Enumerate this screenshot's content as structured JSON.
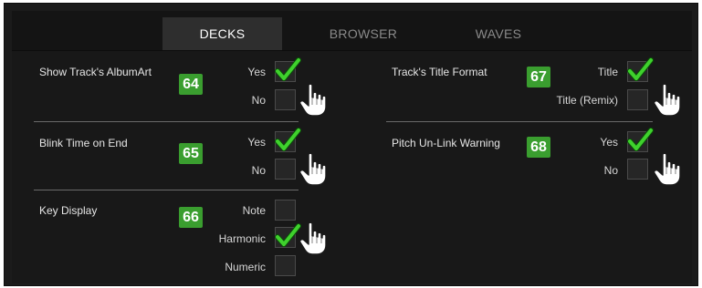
{
  "tabs": [
    {
      "label": "DECKS",
      "active": true
    },
    {
      "label": "BROWSER",
      "active": false
    },
    {
      "label": "WAVES",
      "active": false
    }
  ],
  "settings": [
    {
      "label": "Show Track's AlbumArt",
      "badge": "64",
      "options": [
        {
          "label": "Yes",
          "checked": true
        },
        {
          "label": "No",
          "checked": false
        }
      ]
    },
    {
      "label": "Blink Time on End",
      "badge": "65",
      "options": [
        {
          "label": "Yes",
          "checked": true
        },
        {
          "label": "No",
          "checked": false
        }
      ]
    },
    {
      "label": "Key Display",
      "badge": "66",
      "options": [
        {
          "label": "Note",
          "checked": false
        },
        {
          "label": "Harmonic",
          "checked": true
        },
        {
          "label": "Numeric",
          "checked": false
        }
      ]
    },
    {
      "label": "Track's Title Format",
      "badge": "67",
      "options": [
        {
          "label": "Title",
          "checked": true
        },
        {
          "label": "Title (Remix)",
          "checked": false
        }
      ]
    },
    {
      "label": "Pitch Un-Link Warning",
      "badge": "68",
      "options": [
        {
          "label": "Yes",
          "checked": true
        },
        {
          "label": "No",
          "checked": false
        }
      ]
    }
  ],
  "colors": {
    "background": "#1b1b1b",
    "active_tab": "#2e2e2e",
    "badge": "#3a9e2f",
    "checkmark": "#3fd12d"
  },
  "icons": [
    "checkmark-icon",
    "pointer-hand-icon"
  ]
}
